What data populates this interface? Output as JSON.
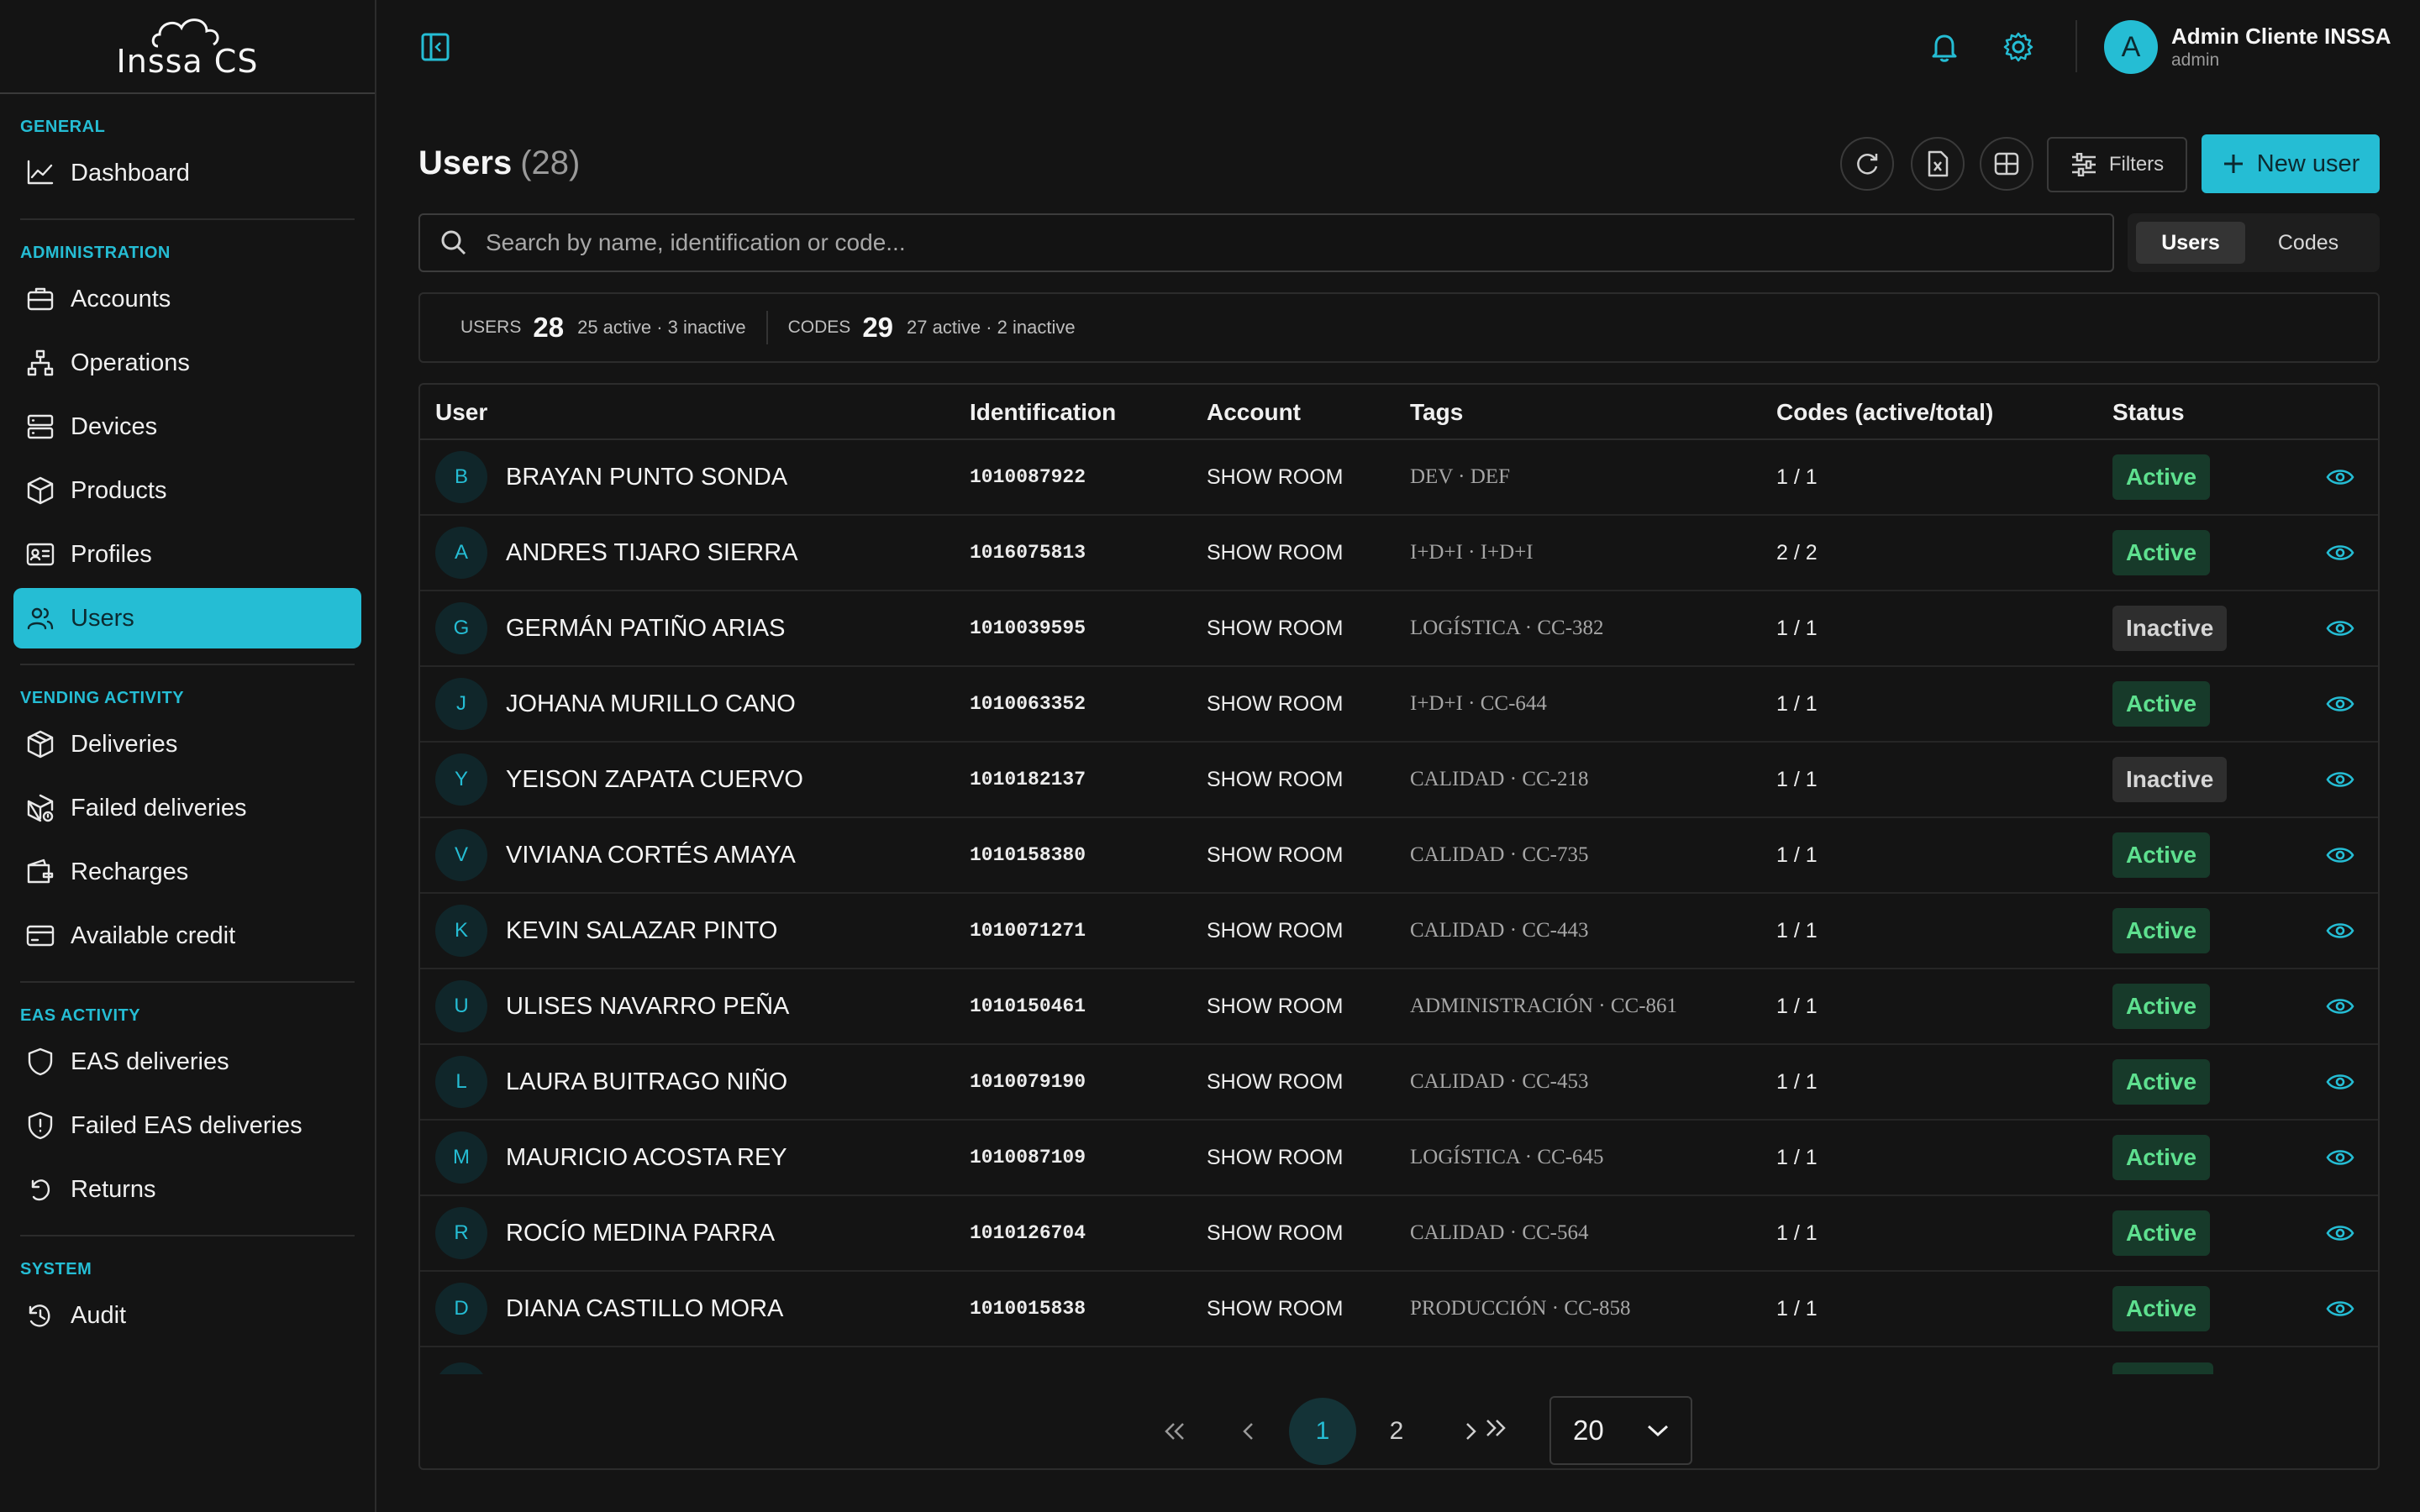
{
  "brand": {
    "logo_text": "Inssa CS"
  },
  "sidebar": {
    "sections": [
      {
        "title": "GENERAL",
        "items": [
          {
            "label": "Dashboard",
            "icon": "chart-line-icon"
          }
        ]
      },
      {
        "title": "ADMINISTRATION",
        "items": [
          {
            "label": "Accounts",
            "icon": "briefcase-icon"
          },
          {
            "label": "Operations",
            "icon": "network-icon"
          },
          {
            "label": "Devices",
            "icon": "server-icon"
          },
          {
            "label": "Products",
            "icon": "box-icon"
          },
          {
            "label": "Profiles",
            "icon": "id-card-icon"
          },
          {
            "label": "Users",
            "icon": "users-icon",
            "active": true
          }
        ]
      },
      {
        "title": "VENDING ACTIVITY",
        "items": [
          {
            "label": "Deliveries",
            "icon": "package-icon"
          },
          {
            "label": "Failed deliveries",
            "icon": "package-alert-icon"
          },
          {
            "label": "Recharges",
            "icon": "wallet-icon"
          },
          {
            "label": "Available credit",
            "icon": "credit-card-icon"
          }
        ]
      },
      {
        "title": "EAS ACTIVITY",
        "items": [
          {
            "label": "EAS deliveries",
            "icon": "shield-icon"
          },
          {
            "label": "Failed EAS deliveries",
            "icon": "shield-alert-icon"
          },
          {
            "label": "Returns",
            "icon": "undo-icon"
          }
        ]
      },
      {
        "title": "SYSTEM",
        "items": [
          {
            "label": "Audit",
            "icon": "history-icon"
          }
        ]
      }
    ]
  },
  "topbar": {
    "user": {
      "initial": "A",
      "name": "Admin Cliente INSSA",
      "role": "admin"
    }
  },
  "page": {
    "title": "Users",
    "count": "(28)",
    "filters_label": "Filters",
    "new_user_label": "New user"
  },
  "search": {
    "placeholder": "Search by name, identification or code...",
    "value": "",
    "toggle": {
      "users": "Users",
      "codes": "Codes",
      "selected": "Users"
    }
  },
  "stats": {
    "users_label": "USERS",
    "users_total": "28",
    "users_sub": "25 active · 3 inactive",
    "codes_label": "CODES",
    "codes_total": "29",
    "codes_sub": "27 active · 2 inactive"
  },
  "table": {
    "columns": [
      "User",
      "Identification",
      "Account",
      "Tags",
      "Codes (active/total)",
      "Status"
    ],
    "rows": [
      {
        "initial": "B",
        "name": "BRAYAN PUNTO SONDA",
        "id": "1010087922",
        "account": "SHOW ROOM",
        "tags": "DEV · DEF",
        "codes": "1 / 1",
        "status": "Active"
      },
      {
        "initial": "A",
        "name": "ANDRES TIJARO SIERRA",
        "id": "1016075813",
        "account": "SHOW ROOM",
        "tags": "I+D+I · I+D+I",
        "codes": "2 / 2",
        "status": "Active"
      },
      {
        "initial": "G",
        "name": "GERMÁN PATIÑO ARIAS",
        "id": "1010039595",
        "account": "SHOW ROOM",
        "tags": "LOGÍSTICA · CC-382",
        "codes": "1 / 1",
        "status": "Inactive"
      },
      {
        "initial": "J",
        "name": "JOHANA MURILLO CANO",
        "id": "1010063352",
        "account": "SHOW ROOM",
        "tags": "I+D+I · CC-644",
        "codes": "1 / 1",
        "status": "Active"
      },
      {
        "initial": "Y",
        "name": "YEISON ZAPATA CUERVO",
        "id": "1010182137",
        "account": "SHOW ROOM",
        "tags": "CALIDAD · CC-218",
        "codes": "1 / 1",
        "status": "Inactive"
      },
      {
        "initial": "V",
        "name": "VIVIANA CORTÉS AMAYA",
        "id": "1010158380",
        "account": "SHOW ROOM",
        "tags": "CALIDAD · CC-735",
        "codes": "1 / 1",
        "status": "Active"
      },
      {
        "initial": "K",
        "name": "KEVIN SALAZAR PINTO",
        "id": "1010071271",
        "account": "SHOW ROOM",
        "tags": "CALIDAD · CC-443",
        "codes": "1 / 1",
        "status": "Active"
      },
      {
        "initial": "U",
        "name": "ULISES NAVARRO PEÑA",
        "id": "1010150461",
        "account": "SHOW ROOM",
        "tags": "ADMINISTRACIÓN · CC-861",
        "codes": "1 / 1",
        "status": "Active"
      },
      {
        "initial": "L",
        "name": "LAURA BUITRAGO NIÑO",
        "id": "1010079190",
        "account": "SHOW ROOM",
        "tags": "CALIDAD · CC-453",
        "codes": "1 / 1",
        "status": "Active"
      },
      {
        "initial": "M",
        "name": "MAURICIO ACOSTA REY",
        "id": "1010087109",
        "account": "SHOW ROOM",
        "tags": "LOGÍSTICA · CC-645",
        "codes": "1 / 1",
        "status": "Active"
      },
      {
        "initial": "R",
        "name": "ROCÍO MEDINA PARRA",
        "id": "1010126704",
        "account": "SHOW ROOM",
        "tags": "CALIDAD · CC-564",
        "codes": "1 / 1",
        "status": "Active"
      },
      {
        "initial": "D",
        "name": "DIANA CASTILLO MORA",
        "id": "1010015838",
        "account": "SHOW ROOM",
        "tags": "PRODUCCIÓN · CC-858",
        "codes": "1 / 1",
        "status": "Active"
      }
    ]
  },
  "pagination": {
    "pages": [
      "1",
      "2"
    ],
    "current": "1",
    "page_size": "20"
  },
  "colors": {
    "accent": "#25bdd4",
    "background": "#141414",
    "active_badge": "#5ee08f",
    "inactive_badge": "#d6d6d6"
  }
}
